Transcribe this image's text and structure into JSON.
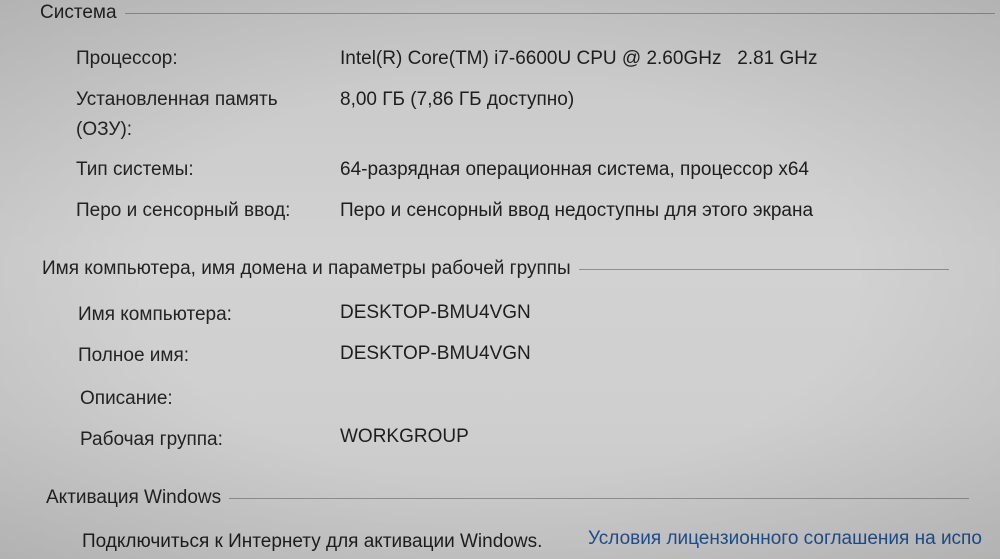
{
  "system": {
    "header": "Система",
    "rows": [
      {
        "label": "Процессор:",
        "value": "Intel(R) Core(TM) i7-6600U CPU @ 2.60GHz   2.81 GHz"
      },
      {
        "label_line1": "Установленная память",
        "label_line2": "(ОЗУ):",
        "value": "8,00 ГБ (7,86 ГБ доступно)"
      },
      {
        "label": "Тип системы:",
        "value": "64-разрядная операционная система, процессор x64"
      },
      {
        "label": "Перо и сенсорный ввод:",
        "value": "Перо и сенсорный ввод недоступны для этого экрана"
      }
    ]
  },
  "computer": {
    "header": "Имя компьютера, имя домена и параметры рабочей группы",
    "rows": [
      {
        "label": "Имя компьютера:",
        "value": "DESKTOP-BMU4VGN"
      },
      {
        "label": "Полное имя:",
        "value": "DESKTOP-BMU4VGN"
      },
      {
        "label": "Описание:",
        "value": ""
      },
      {
        "label": "Рабочая группа:",
        "value": "WORKGROUP"
      }
    ]
  },
  "activation": {
    "header": "Активация Windows",
    "text": "Подключиться к Интернету для активации Windows.",
    "license_link": "Условия лицензионного соглашения на испо"
  }
}
